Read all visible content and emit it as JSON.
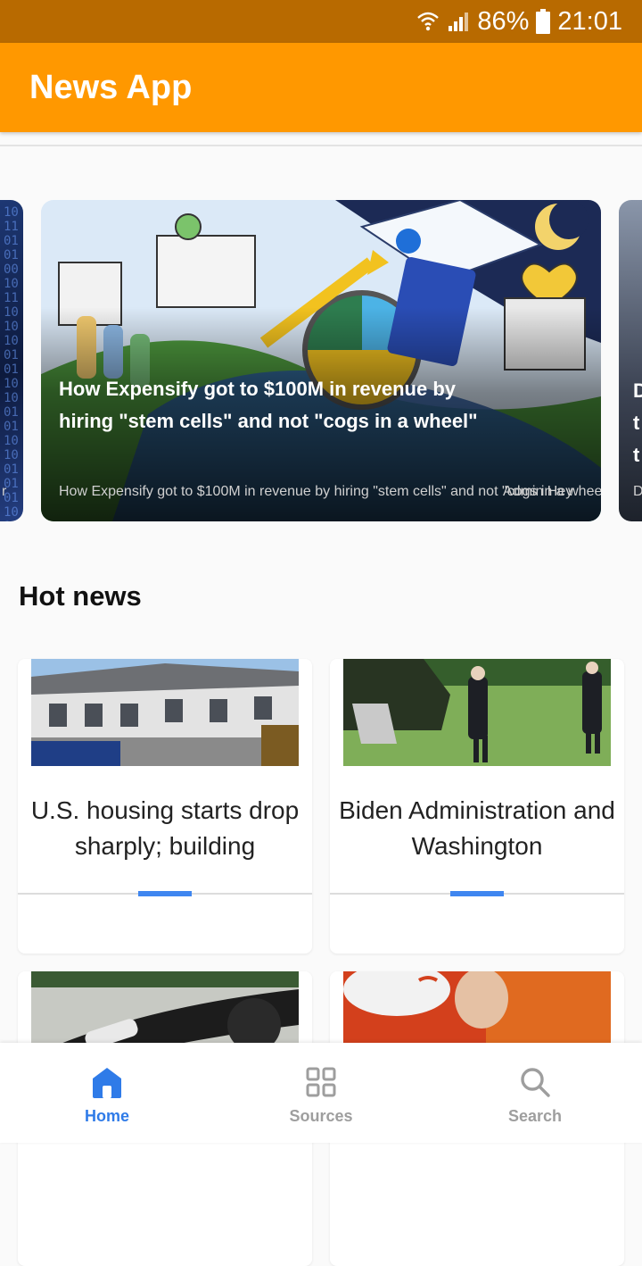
{
  "status_bar": {
    "battery": "86%",
    "time": "21:01"
  },
  "app_bar": {
    "title": "News App"
  },
  "carousel": {
    "left_card": {
      "source_initial": "r"
    },
    "main_card": {
      "title": "How Expensify got to $100M in revenue by hiring \"stem cells\" and not \"cogs in a wheel\"",
      "description": "How Expensify got to $100M in revenue by hiring \"stem cells\" and not \"cogs in a wheel\"",
      "source": "Admin Hey"
    },
    "right_card": {
      "title_fragment": "D\nt\nt",
      "source_initial": "D"
    }
  },
  "hot_news": {
    "title": "Hot news",
    "items": [
      {
        "headline": "U.S. housing starts drop sharply; building"
      },
      {
        "headline": "Biden Administration and Washington"
      },
      {
        "headline": ""
      },
      {
        "headline": ""
      }
    ]
  },
  "bottom_nav": {
    "items": [
      {
        "label": "Home",
        "icon": "home-icon",
        "active": true
      },
      {
        "label": "Sources",
        "icon": "grid-icon",
        "active": false
      },
      {
        "label": "Search",
        "icon": "search-icon",
        "active": false
      }
    ]
  },
  "colors": {
    "app_bar": "#ff9800",
    "status_bar": "#b86a00",
    "accent": "#2f7be8"
  }
}
